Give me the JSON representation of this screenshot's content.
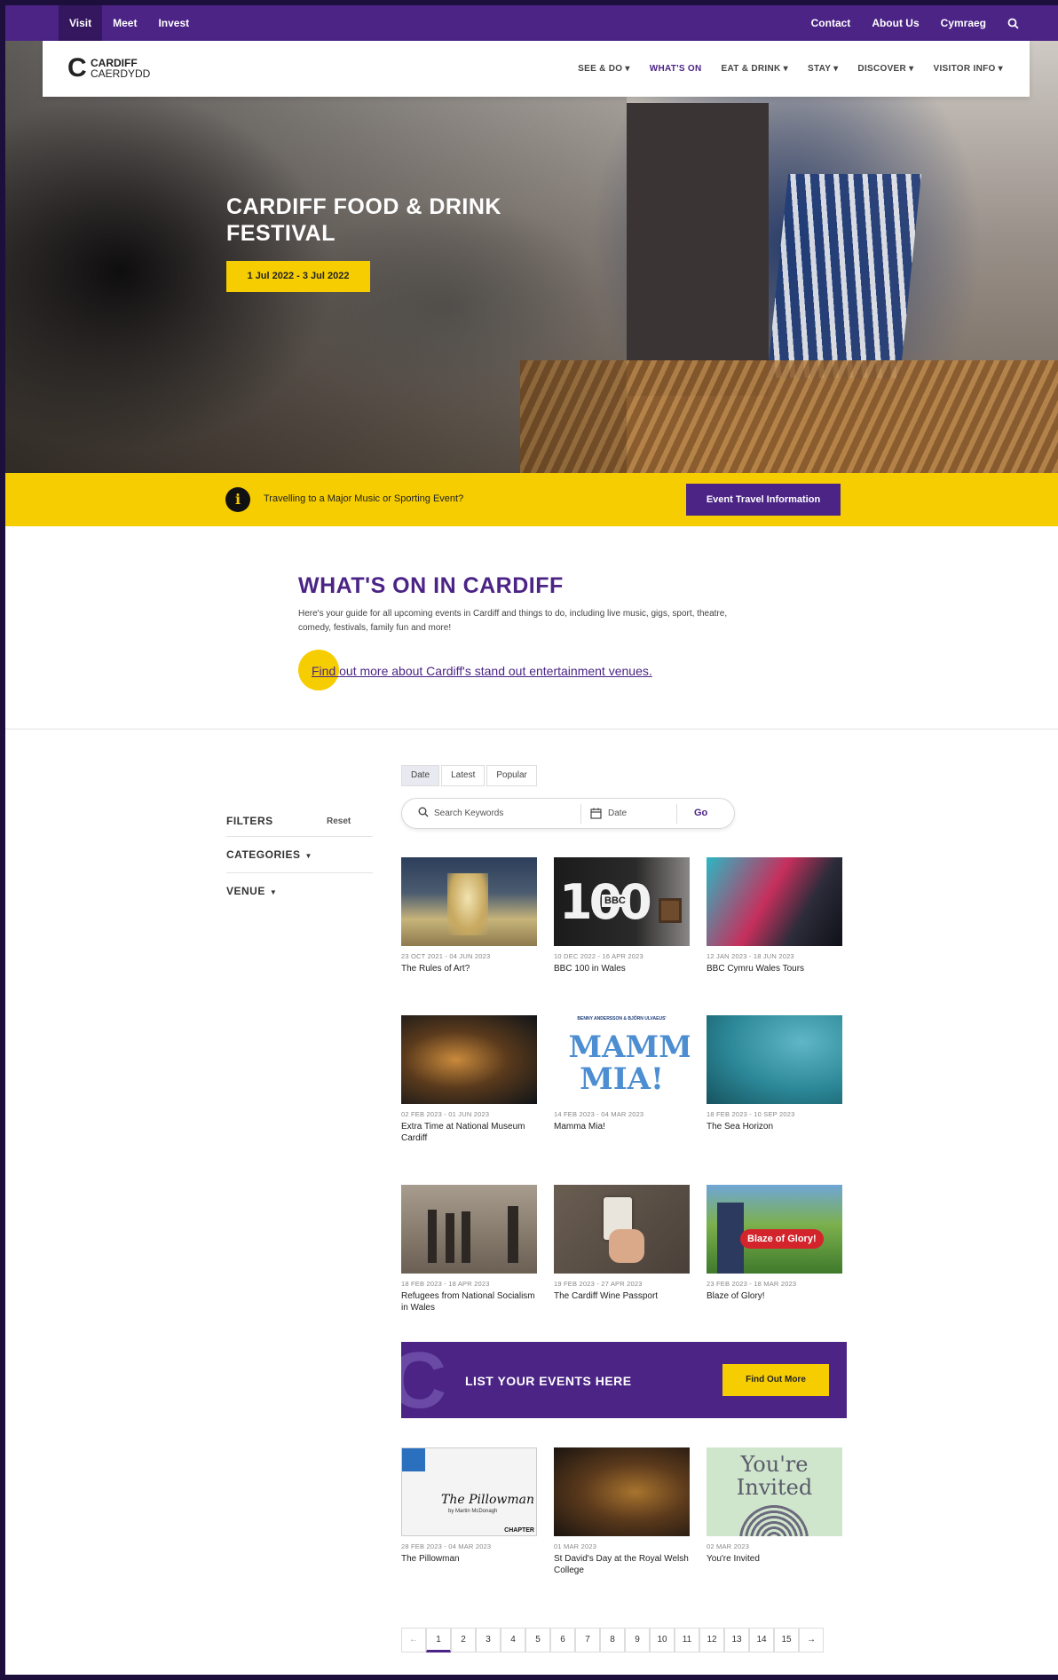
{
  "topbar": {
    "left": [
      "Visit",
      "Meet",
      "Invest"
    ],
    "right": [
      "Contact",
      "About Us",
      "Cymraeg"
    ]
  },
  "logo": {
    "line1": "CARDIFF",
    "line2": "CAERDYDD"
  },
  "nav": {
    "items": [
      {
        "label": "SEE & DO",
        "has_dropdown": true
      },
      {
        "label": "WHAT'S ON",
        "has_dropdown": false
      },
      {
        "label": "EAT & DRINK",
        "has_dropdown": true
      },
      {
        "label": "STAY",
        "has_dropdown": true
      },
      {
        "label": "DISCOVER",
        "has_dropdown": true
      },
      {
        "label": "VISITOR INFO",
        "has_dropdown": true
      }
    ]
  },
  "hero": {
    "title": "CARDIFF FOOD & DRINK FESTIVAL",
    "date": "1 Jul 2022 - 3 Jul 2022"
  },
  "travel": {
    "message": "Travelling to a Major Music or Sporting Event?",
    "button": "Event Travel Information"
  },
  "intro": {
    "title": "WHAT'S ON IN CARDIFF",
    "text": "Here's your guide for all upcoming events in Cardiff and things to do, including live music, gigs, sport, theatre, comedy, festivals, family fun and more!",
    "link": "Find out more about Cardiff's stand out entertainment venues."
  },
  "filters": {
    "heading": "FILTERS",
    "reset": "Reset",
    "categories": "CATEGORIES",
    "venue": "VENUE"
  },
  "sort": [
    "Date",
    "Latest",
    "Popular"
  ],
  "search": {
    "placeholder": "Search Keywords",
    "date": "Date",
    "go": "Go"
  },
  "events": [
    {
      "date": "23 OCT 2021 - 04 JUN 2023",
      "name": "The Rules of Art?"
    },
    {
      "date": "10 DEC 2022 - 16 APR 2023",
      "name": "BBC 100 in Wales"
    },
    {
      "date": "12 JAN 2023 - 18 JUN 2023",
      "name": "BBC Cymru Wales Tours"
    },
    {
      "date": "02 FEB 2023 - 01 JUN 2023",
      "name": "Extra Time at National Museum Cardiff"
    },
    {
      "date": "14 FEB 2023 - 04 MAR 2023",
      "name": "Mamma Mia!"
    },
    {
      "date": "18 FEB 2023 - 10 SEP 2023",
      "name": "The Sea Horizon"
    },
    {
      "date": "18 FEB 2023 - 18 APR 2023",
      "name": "Refugees from National Socialism in Wales"
    },
    {
      "date": "19 FEB 2023 - 27 APR 2023",
      "name": "The Cardiff Wine Passport"
    },
    {
      "date": "23 FEB 2023 - 18 MAR 2023",
      "name": "Blaze of Glory!"
    },
    {
      "date": "28 FEB 2023 - 04 MAR 2023",
      "name": "The Pillowman"
    },
    {
      "date": "01 MAR 2023",
      "name": "St David's Day at the Royal Welsh College"
    },
    {
      "date": "02 MAR 2023",
      "name": "You're Invited"
    }
  ],
  "image_text": {
    "bbc100": "100",
    "bbc": "BBC",
    "mamma_small": "BENNY ANDERSSON & BJÖRN ULVAEUS'",
    "mamma": "MAMMA MIA!",
    "blaze": "Blaze of Glory!",
    "pillowman": "The Pillowman",
    "pillowman_sub": "by Martin McDonagh",
    "chapter": "CHAPTER",
    "invited": "You're Invited"
  },
  "promo": {
    "title": "LIST YOUR EVENTS HERE",
    "button": "Find Out More"
  },
  "pagination": {
    "prev": "←",
    "pages": [
      "1",
      "2",
      "3",
      "4",
      "5",
      "6",
      "7",
      "8",
      "9",
      "10",
      "11",
      "12",
      "13",
      "14",
      "15"
    ],
    "current": "1",
    "next": "→"
  },
  "colors": {
    "brand_purple": "#4b2486",
    "brand_yellow": "#f6cd00"
  }
}
